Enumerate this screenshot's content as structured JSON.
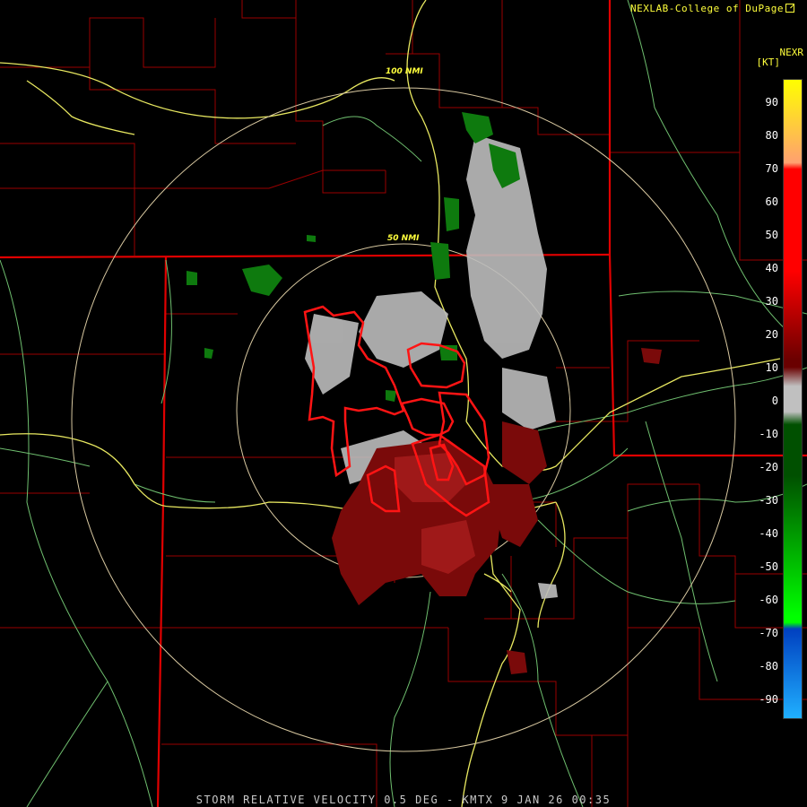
{
  "header": {
    "credit": "NEXLAB-College of DuPage",
    "product": "NEXR",
    "unit": "[KT]"
  },
  "footer": {
    "caption": "STORM RELATIVE VELOCITY 0.5 DEG - KMTX 9 JAN 26 00:35"
  },
  "range_rings": [
    {
      "label": "100 NMI"
    },
    {
      "label": "50 NMI"
    }
  ],
  "colorbar": {
    "ticks": [
      "90",
      "80",
      "70",
      "60",
      "50",
      "40",
      "30",
      "20",
      "10",
      "0",
      "-10",
      "-20",
      "-30",
      "-40",
      "-50",
      "-60",
      "-70",
      "-80",
      "-90"
    ],
    "colors": {
      "high": "#ffff00",
      "orange": "#ffa070",
      "red": "#ff0000",
      "darkred": "#6a0000",
      "gray": "#c0c0c0",
      "darkgreen": "#005000",
      "green": "#00ff00",
      "blue": "#0040c0",
      "lightblue": "#20b0ff"
    }
  },
  "colors": {
    "background": "#000000",
    "state_borders": "#e00000",
    "county_lines": "#a00000",
    "highways": "#e8e860",
    "roads": "#70c070",
    "range_rings": "#d8c8a0",
    "warning_polygons": "#ff1010"
  }
}
